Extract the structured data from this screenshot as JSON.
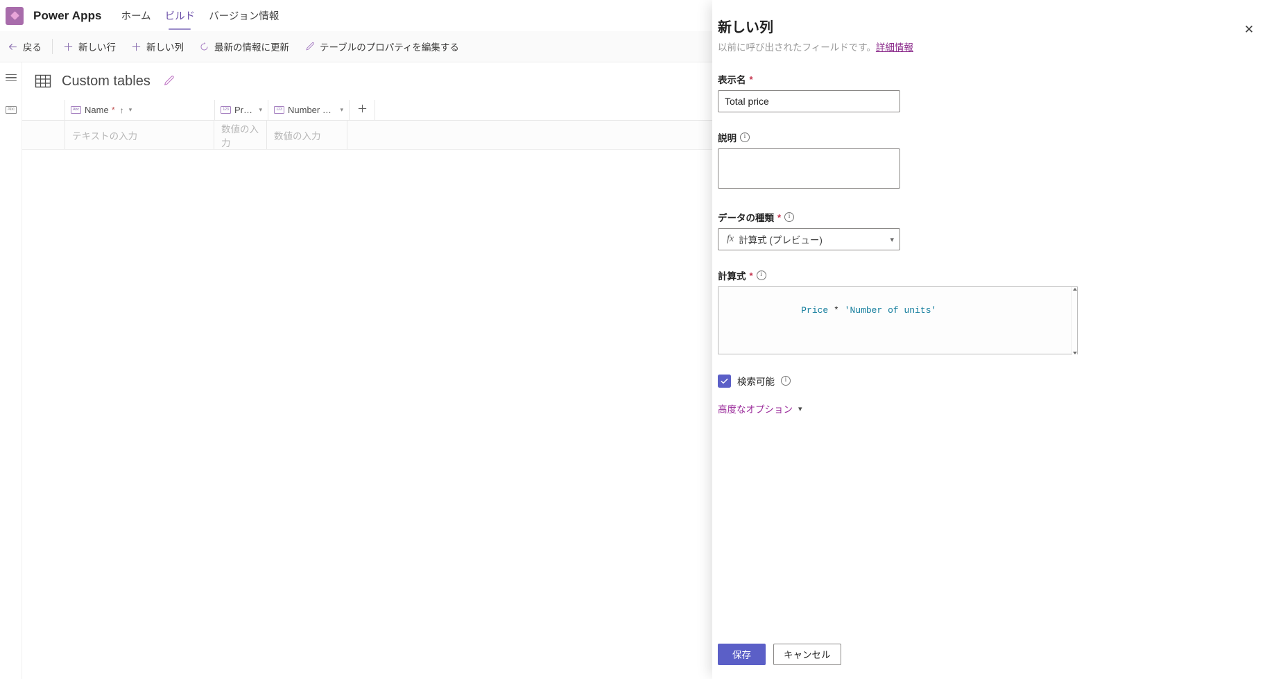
{
  "app": {
    "brand": "Power Apps",
    "logo_icon": "powerapps-diamond-icon",
    "nav": [
      {
        "label": "ホーム",
        "active": false
      },
      {
        "label": "ビルド",
        "active": true
      },
      {
        "label": "バージョン情報",
        "active": false
      }
    ]
  },
  "command_bar": {
    "items": [
      {
        "label": "戻る",
        "icon": "arrow-left-icon"
      },
      {
        "label": "新しい行",
        "icon": "plus-icon"
      },
      {
        "label": "新しい列",
        "icon": "plus-icon"
      },
      {
        "label": "最新の情報に更新",
        "icon": "refresh-icon"
      },
      {
        "label": "テーブルのプロパティを編集する",
        "icon": "pencil-icon"
      }
    ]
  },
  "left_rail": {
    "items": [
      {
        "name": "hamburger-menu-icon"
      },
      {
        "name": "abc-text-column-icon"
      }
    ]
  },
  "table_view": {
    "icon": "grid-table-icon",
    "title": "Custom tables",
    "rename_icon": "pencil-icon",
    "add_column_icon": "plus-icon",
    "columns": [
      {
        "label": "Name",
        "type_chip": "Abc",
        "required": true,
        "sorted": "asc",
        "has_menu": true
      },
      {
        "label": "Price",
        "type_chip": "123",
        "required": false,
        "sorted": "",
        "has_menu": true
      },
      {
        "label": "Number of un...",
        "type_chip": "123",
        "required": false,
        "sorted": "",
        "has_menu": true
      }
    ],
    "new_row_placeholders": {
      "name": "テキストの入力",
      "price": "数値の入力",
      "units": "数値の入力"
    }
  },
  "panel": {
    "title": "新しい列",
    "subtitle_text": "以前に呼び出されたフィールドです。",
    "subtitle_link": "詳細情報",
    "close_icon": "close-icon",
    "fields": {
      "display_name": {
        "label": "表示名",
        "required": true,
        "value": "Total price",
        "placeholder": ""
      },
      "description": {
        "label": "説明",
        "has_info": true,
        "value": "",
        "placeholder": ""
      },
      "data_type": {
        "label": "データの種類",
        "required": true,
        "has_info": true,
        "selected": "計算式 (プレビュー)",
        "prefix_icon": "fx",
        "chevron_icon": "chevron-down-icon"
      },
      "formula": {
        "label": "計算式",
        "required": true,
        "has_info": true,
        "tokens": [
          {
            "text": "Price",
            "kind": "identifier"
          },
          {
            "text": " ",
            "kind": "plain"
          },
          {
            "text": "*",
            "kind": "operator"
          },
          {
            "text": " ",
            "kind": "plain"
          },
          {
            "text": "'Number of units'",
            "kind": "string"
          }
        ],
        "raw": "Price * 'Number of units'"
      },
      "searchable": {
        "label": "検索可能",
        "checked": true,
        "has_info": true,
        "check_icon": "checkmark-icon"
      },
      "advanced": {
        "label": "高度なオプション",
        "chevron_icon": "chevron-down-icon"
      }
    },
    "footer": {
      "save_label": "保存",
      "cancel_label": "キャンセル"
    }
  },
  "colors": {
    "brand_purple": "#5b5fc7",
    "link_magenta": "#8b2a8b",
    "accent_pink": "#c178c6",
    "required_red": "#c4314b",
    "formula_identifier": "#127c9c",
    "logo_tile": "#a86cab"
  }
}
